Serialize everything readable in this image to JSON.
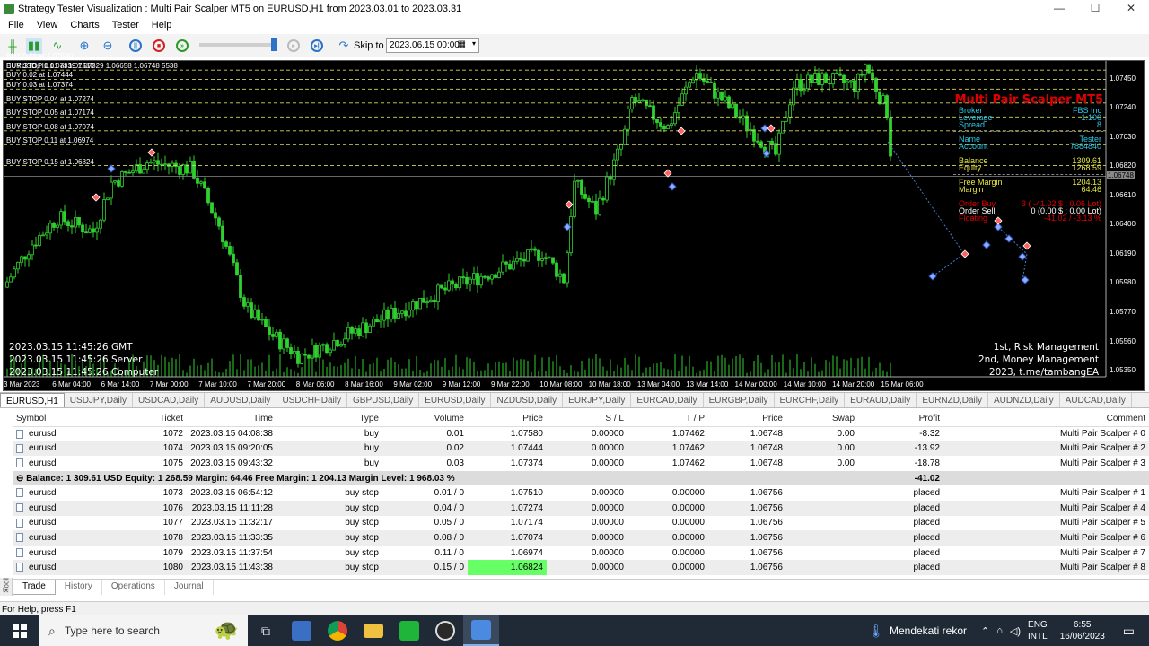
{
  "window": {
    "title": "Strategy Tester Visualization : Multi Pair Scalper MT5 on EURUSD,H1 from 2023.03.01 to 2023.03.31",
    "minimize": "—",
    "maximize": "☐",
    "close": "✕"
  },
  "menu": [
    "File",
    "View",
    "Charts",
    "Tester",
    "Help"
  ],
  "toolbar": {
    "skip_label": "Skip to",
    "skip_value": "2023.06.15 00:00"
  },
  "chart": {
    "header_line": "EURUSD,H1 1.07339 1.07329 1.06658 1.06748 5538",
    "order_lines": [
      {
        "label": "BUY STOP 0.01 at 1.07510",
        "price": 1.0751
      },
      {
        "label": "BUY 0.01 at 1.07580",
        "price": 1.0758
      },
      {
        "label": "BUY 0.02 at 1.07444",
        "price": 1.07444
      },
      {
        "label": "BUY 0.03 at 1.07374",
        "price": 1.07374
      },
      {
        "label": "BUY STOP 0.04 at 1.07274",
        "price": 1.07274
      },
      {
        "label": "BUY STOP 0.05 at 1.07174",
        "price": 1.07174
      },
      {
        "label": "BUY STOP 0.08 at 1.07074",
        "price": 1.07074
      },
      {
        "label": "BUY STOP 0.11 at 1.06974",
        "price": 1.06974
      },
      {
        "label": "BUY STOP 0.15 at 1.06824",
        "price": 1.06824
      }
    ],
    "price_ticks": [
      "1.07450",
      "1.07240",
      "1.07030",
      "1.06820",
      "1.06610",
      "1.06400",
      "1.06190",
      "1.05980",
      "1.05770",
      "1.05560",
      "1.05350"
    ],
    "current_price": "1.06748",
    "time_ticks": [
      "3 Mar 2023",
      "6 Mar 04:00",
      "6 Mar 14:00",
      "7 Mar 00:00",
      "7 Mar 10:00",
      "7 Mar 20:00",
      "8 Mar 06:00",
      "8 Mar 16:00",
      "9 Mar 02:00",
      "9 Mar 12:00",
      "9 Mar 22:00",
      "10 Mar 08:00",
      "10 Mar 18:00",
      "13 Mar 04:00",
      "13 Mar 14:00",
      "14 Mar 00:00",
      "14 Mar 10:00",
      "14 Mar 20:00",
      "15 Mar 06:00"
    ],
    "timestamps": [
      "2023.03.15 11:45:26 GMT",
      "2023.03.15 11:45:26 Server",
      "2023.03.15 11:45:26 Computer"
    ],
    "right_notes": [
      "1st, Risk Management",
      "2nd, Money Management",
      "2023, t.me/tambangEA"
    ],
    "colors": {
      "bull": "#2fd12f",
      "grid_line": "#d8d860",
      "bid": "#8a8a8a",
      "panel_title": "#e00000"
    }
  },
  "ea_panel": {
    "title": "Multi Pair Scalper MT5",
    "groups": [
      [
        {
          "k": "Broker",
          "v": "FBS Inc",
          "color": "#29c9e8"
        },
        {
          "k": "Leverage",
          "v": "1:100",
          "color": "#29c9e8"
        },
        {
          "k": "Spread",
          "v": "8",
          "color": "#29c9e8"
        }
      ],
      [
        {
          "k": "Name",
          "v": "Tester",
          "color": "#29c9e8"
        },
        {
          "k": "Account",
          "v": "7884840",
          "color": "#29c9e8"
        }
      ],
      [
        {
          "k": "Balance",
          "v": "1309.61",
          "color": "#e8e840"
        },
        {
          "k": "Equity",
          "v": "1268.59",
          "color": "#e8e840"
        }
      ],
      [
        {
          "k": "Free Margin",
          "v": "1204.13",
          "color": "#e8e840"
        },
        {
          "k": "Margin",
          "v": "64.46",
          "color": "#e8e840"
        }
      ],
      [
        {
          "k": "Order Buy",
          "v": "3 ( -41.02 $ : 0.06 Lot)",
          "color": "#e00000"
        },
        {
          "k": "Order Sell",
          "v": "0 (0.00 $ : 0.00 Lot)",
          "color": "#ffffff"
        },
        {
          "k": "Floating",
          "v": "-41.02 / -3.13 %",
          "color": "#e00000"
        }
      ]
    ]
  },
  "symbol_tabs": [
    "EURUSD,H1",
    "USDJPY,Daily",
    "USDCAD,Daily",
    "AUDUSD,Daily",
    "USDCHF,Daily",
    "GBPUSD,Daily",
    "EURUSD,Daily",
    "NZDUSD,Daily",
    "EURJPY,Daily",
    "EURCAD,Daily",
    "EURGBP,Daily",
    "EURCHF,Daily",
    "EURAUD,Daily",
    "EURNZD,Daily",
    "AUDNZD,Daily",
    "AUDCAD,Daily"
  ],
  "trade_table": {
    "columns": [
      "Symbol",
      "Ticket",
      "Time",
      "Type",
      "Volume",
      "Price",
      "S / L",
      "T / P",
      "Price",
      "Swap",
      "Profit",
      "Comment"
    ],
    "positions": [
      [
        "eurusd",
        "1072",
        "2023.03.15 04:08:38",
        "buy",
        "0.01",
        "1.07580",
        "0.00000",
        "1.07462",
        "1.06748",
        "0.00",
        "-8.32",
        "Multi Pair Scalper # 0"
      ],
      [
        "eurusd",
        "1074",
        "2023.03.15 09:20:05",
        "buy",
        "0.02",
        "1.07444",
        "0.00000",
        "1.07462",
        "1.06748",
        "0.00",
        "-13.92",
        "Multi Pair Scalper # 2"
      ],
      [
        "eurusd",
        "1075",
        "2023.03.15 09:43:32",
        "buy",
        "0.03",
        "1.07374",
        "0.00000",
        "1.07462",
        "1.06748",
        "0.00",
        "-18.78",
        "Multi Pair Scalper # 3"
      ]
    ],
    "balance_line": "Balance: 1 309.61 USD  Equity: 1 268.59  Margin: 64.46  Free Margin: 1 204.13  Margin Level: 1 968.03 %",
    "balance_profit": "-41.02",
    "orders": [
      [
        "eurusd",
        "1073",
        "2023.03.15 06:54:12",
        "buy stop",
        "0.01 / 0",
        "1.07510",
        "0.00000",
        "0.00000",
        "1.06756",
        "",
        "placed",
        "Multi Pair Scalper # 1"
      ],
      [
        "eurusd",
        "1076",
        "2023.03.15 11:11:28",
        "buy stop",
        "0.04 / 0",
        "1.07274",
        "0.00000",
        "0.00000",
        "1.06756",
        "",
        "placed",
        "Multi Pair Scalper # 4"
      ],
      [
        "eurusd",
        "1077",
        "2023.03.15 11:32:17",
        "buy stop",
        "0.05 / 0",
        "1.07174",
        "0.00000",
        "0.00000",
        "1.06756",
        "",
        "placed",
        "Multi Pair Scalper # 5"
      ],
      [
        "eurusd",
        "1078",
        "2023.03.15 11:33:35",
        "buy stop",
        "0.08 / 0",
        "1.07074",
        "0.00000",
        "0.00000",
        "1.06756",
        "",
        "placed",
        "Multi Pair Scalper # 6"
      ],
      [
        "eurusd",
        "1079",
        "2023.03.15 11:37:54",
        "buy stop",
        "0.11 / 0",
        "1.06974",
        "0.00000",
        "0.00000",
        "1.06756",
        "",
        "placed",
        "Multi Pair Scalper # 7"
      ],
      [
        "eurusd",
        "1080",
        "2023.03.15 11:43:38",
        "buy stop",
        "0.15 / 0",
        "1.06824",
        "0.00000",
        "0.00000",
        "1.06756",
        "",
        "placed",
        "Multi Pair Scalper # 8"
      ]
    ]
  },
  "bottom_tabs": [
    "Trade",
    "History",
    "Operations",
    "Journal"
  ],
  "toolbox_label": "Toolbox",
  "status": "For Help, press F1",
  "taskbar": {
    "search_placeholder": "Type here to search",
    "weather": "Mendekati rekor",
    "lang": "ENG",
    "layout": "INTL",
    "time": "6:55",
    "date": "16/06/2023"
  }
}
